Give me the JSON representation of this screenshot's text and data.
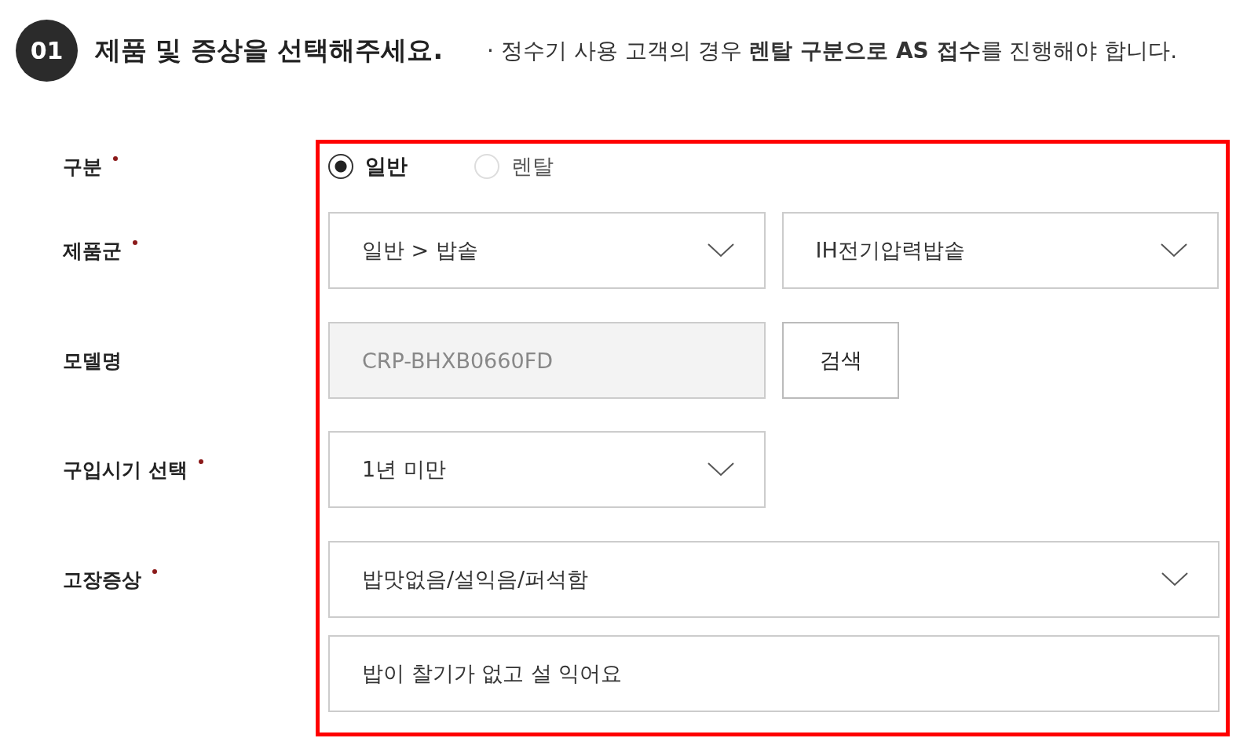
{
  "step": {
    "number": "01",
    "title": "제품 및 증상을 선택해주세요.",
    "note": "· 정수기 사용 고객의 경우 **렌탈 구분으로 AS 접수**를 진행해야 합니다."
  },
  "fields": [
    {
      "kind": "radio",
      "label": "구분",
      "required": true,
      "options": [
        {
          "label": "일반",
          "selected": true
        },
        {
          "label": "렌탈",
          "selected": false
        }
      ]
    },
    {
      "kind": "selects",
      "label": "제품군",
      "required": true,
      "selects": [
        {
          "value": "일반 > 밥솥"
        },
        {
          "value": "IH전기압력밥솥"
        }
      ]
    },
    {
      "kind": "search",
      "label": "모델명",
      "required": false,
      "input": {
        "value": "CRP-BHXB0660FD",
        "disabled": true
      },
      "button": "검색"
    },
    {
      "kind": "selects",
      "label": "구입시기 선택",
      "required": true,
      "selects": [
        {
          "value": "1년 미만"
        }
      ]
    },
    {
      "kind": "symptom",
      "label": "고장증상",
      "required": true,
      "selects": [
        {
          "value": "밥맛없음/설익음/퍼석함"
        }
      ],
      "text": {
        "value": "밥이 찰기가 없고 설 익어요"
      }
    }
  ]
}
